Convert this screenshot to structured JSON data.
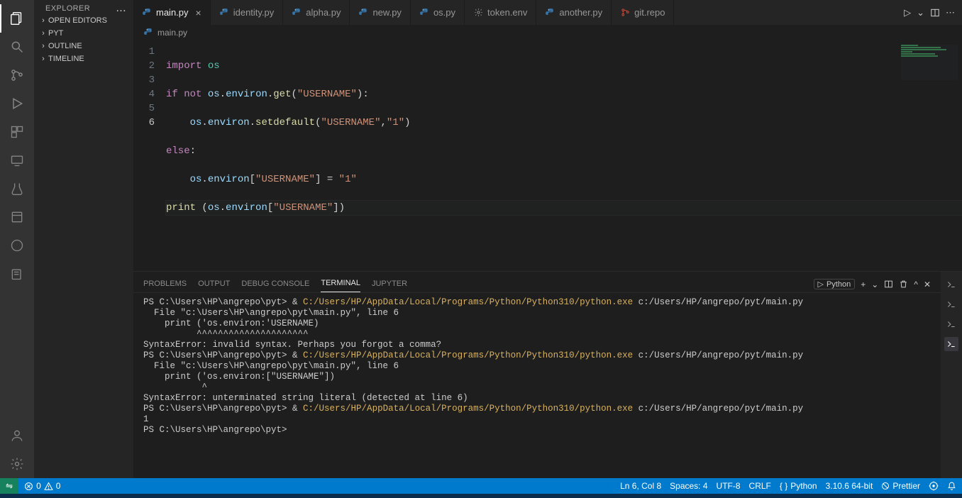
{
  "sidebar": {
    "title": "EXPLORER",
    "more_label": "...",
    "sections": [
      "OPEN EDITORS",
      "PYT",
      "OUTLINE",
      "TIMELINE"
    ]
  },
  "tabs": [
    {
      "name": "main.py",
      "active": true,
      "icon": "python"
    },
    {
      "name": "identity.py",
      "active": false,
      "icon": "python"
    },
    {
      "name": "alpha.py",
      "active": false,
      "icon": "python"
    },
    {
      "name": "new.py",
      "active": false,
      "icon": "python"
    },
    {
      "name": "os.py",
      "active": false,
      "icon": "python"
    },
    {
      "name": "token.env",
      "active": false,
      "icon": "gear"
    },
    {
      "name": "another.py",
      "active": false,
      "icon": "python"
    },
    {
      "name": "git.repo",
      "active": false,
      "icon": "git"
    }
  ],
  "tabs_actions": {
    "run": "▷",
    "splitdown": "⌄",
    "split": "▯▯",
    "more": "⋯"
  },
  "breadcrumb": {
    "file": "main.py"
  },
  "code": {
    "line_numbers": [
      "1",
      "2",
      "3",
      "4",
      "5",
      "6"
    ],
    "l1": {
      "kw_import": "import",
      "mod": "os"
    },
    "l2": {
      "kw_if": "if",
      "kw_not": "not",
      "var": "os",
      "prop": "environ",
      "fn": "get",
      "str": "\"USERNAME\""
    },
    "l3": {
      "var": "os",
      "prop": "environ",
      "fn": "setdefault",
      "str1": "\"USERNAME\"",
      "str2": "\"1\""
    },
    "l4": {
      "kw": "else"
    },
    "l5": {
      "var": "os",
      "prop": "environ",
      "str1": "\"USERNAME\"",
      "str2": "\"1\""
    },
    "l6": {
      "fn": "print",
      "var": "os",
      "prop": "environ",
      "str": "\"USERNAME\""
    }
  },
  "panel": {
    "tabs": [
      "PROBLEMS",
      "OUTPUT",
      "DEBUG CONSOLE",
      "TERMINAL",
      "JUPYTER"
    ],
    "active_tab_index": 3,
    "launch_label": "Python",
    "actions": {
      "plus": "+",
      "chev": "⌄",
      "split": "▯▯",
      "trash": "🗑",
      "up": "^",
      "close": "✕"
    },
    "terminal_lines": [
      {
        "prompt": "PS C:\\Users\\HP\\angrepo\\pyt> & ",
        "path": "C:/Users/HP/AppData/Local/Programs/Python/Python310/python.exe",
        "rest": " c:/Users/HP/angrepo/pyt/main.py"
      },
      {
        "plain": "  File \"c:\\Users\\HP\\angrepo\\pyt\\main.py\", line 6"
      },
      {
        "plain": "    print ('os.environ:'USERNAME)"
      },
      {
        "plain": "          ^^^^^^^^^^^^^^^^^^^^^"
      },
      {
        "plain": "SyntaxError: invalid syntax. Perhaps you forgot a comma?"
      },
      {
        "prompt": "PS C:\\Users\\HP\\angrepo\\pyt> & ",
        "path": "C:/Users/HP/AppData/Local/Programs/Python/Python310/python.exe",
        "rest": " c:/Users/HP/angrepo/pyt/main.py"
      },
      {
        "plain": "  File \"c:\\Users\\HP\\angrepo\\pyt\\main.py\", line 6"
      },
      {
        "plain": "    print ('os.environ:[\"USERNAME\"])"
      },
      {
        "plain": "           ^"
      },
      {
        "plain": "SyntaxError: unterminated string literal (detected at line 6)"
      },
      {
        "prompt": "PS C:\\Users\\HP\\angrepo\\pyt> & ",
        "path": "C:/Users/HP/AppData/Local/Programs/Python/Python310/python.exe",
        "rest": " c:/Users/HP/angrepo/pyt/main.py"
      },
      {
        "plain": "1"
      },
      {
        "prompt": "PS C:\\Users\\HP\\angrepo\\pyt> "
      }
    ]
  },
  "status": {
    "remote_glyph": "⇋",
    "errors": "0",
    "warnings": "0",
    "ln_col": "Ln 6, Col 8",
    "spaces": "Spaces: 4",
    "encoding": "UTF-8",
    "eol": "CRLF",
    "language": "Python",
    "interpreter": "3.10.6 64-bit",
    "prettier": "Prettier"
  }
}
